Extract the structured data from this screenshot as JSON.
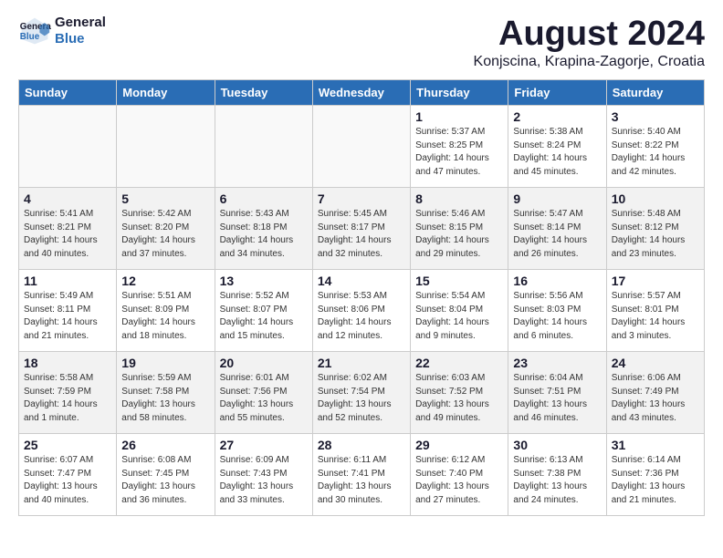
{
  "header": {
    "logo_line1": "General",
    "logo_line2": "Blue",
    "title": "August 2024",
    "subtitle": "Konjscina, Krapina-Zagorje, Croatia"
  },
  "days_of_week": [
    "Sunday",
    "Monday",
    "Tuesday",
    "Wednesday",
    "Thursday",
    "Friday",
    "Saturday"
  ],
  "weeks": [
    [
      {
        "day": "",
        "info": "",
        "empty": true
      },
      {
        "day": "",
        "info": "",
        "empty": true
      },
      {
        "day": "",
        "info": "",
        "empty": true
      },
      {
        "day": "",
        "info": "",
        "empty": true
      },
      {
        "day": "1",
        "info": "Sunrise: 5:37 AM\nSunset: 8:25 PM\nDaylight: 14 hours\nand 47 minutes."
      },
      {
        "day": "2",
        "info": "Sunrise: 5:38 AM\nSunset: 8:24 PM\nDaylight: 14 hours\nand 45 minutes."
      },
      {
        "day": "3",
        "info": "Sunrise: 5:40 AM\nSunset: 8:22 PM\nDaylight: 14 hours\nand 42 minutes."
      }
    ],
    [
      {
        "day": "4",
        "info": "Sunrise: 5:41 AM\nSunset: 8:21 PM\nDaylight: 14 hours\nand 40 minutes."
      },
      {
        "day": "5",
        "info": "Sunrise: 5:42 AM\nSunset: 8:20 PM\nDaylight: 14 hours\nand 37 minutes."
      },
      {
        "day": "6",
        "info": "Sunrise: 5:43 AM\nSunset: 8:18 PM\nDaylight: 14 hours\nand 34 minutes."
      },
      {
        "day": "7",
        "info": "Sunrise: 5:45 AM\nSunset: 8:17 PM\nDaylight: 14 hours\nand 32 minutes."
      },
      {
        "day": "8",
        "info": "Sunrise: 5:46 AM\nSunset: 8:15 PM\nDaylight: 14 hours\nand 29 minutes."
      },
      {
        "day": "9",
        "info": "Sunrise: 5:47 AM\nSunset: 8:14 PM\nDaylight: 14 hours\nand 26 minutes."
      },
      {
        "day": "10",
        "info": "Sunrise: 5:48 AM\nSunset: 8:12 PM\nDaylight: 14 hours\nand 23 minutes."
      }
    ],
    [
      {
        "day": "11",
        "info": "Sunrise: 5:49 AM\nSunset: 8:11 PM\nDaylight: 14 hours\nand 21 minutes."
      },
      {
        "day": "12",
        "info": "Sunrise: 5:51 AM\nSunset: 8:09 PM\nDaylight: 14 hours\nand 18 minutes."
      },
      {
        "day": "13",
        "info": "Sunrise: 5:52 AM\nSunset: 8:07 PM\nDaylight: 14 hours\nand 15 minutes."
      },
      {
        "day": "14",
        "info": "Sunrise: 5:53 AM\nSunset: 8:06 PM\nDaylight: 14 hours\nand 12 minutes."
      },
      {
        "day": "15",
        "info": "Sunrise: 5:54 AM\nSunset: 8:04 PM\nDaylight: 14 hours\nand 9 minutes."
      },
      {
        "day": "16",
        "info": "Sunrise: 5:56 AM\nSunset: 8:03 PM\nDaylight: 14 hours\nand 6 minutes."
      },
      {
        "day": "17",
        "info": "Sunrise: 5:57 AM\nSunset: 8:01 PM\nDaylight: 14 hours\nand 3 minutes."
      }
    ],
    [
      {
        "day": "18",
        "info": "Sunrise: 5:58 AM\nSunset: 7:59 PM\nDaylight: 14 hours\nand 1 minute."
      },
      {
        "day": "19",
        "info": "Sunrise: 5:59 AM\nSunset: 7:58 PM\nDaylight: 13 hours\nand 58 minutes."
      },
      {
        "day": "20",
        "info": "Sunrise: 6:01 AM\nSunset: 7:56 PM\nDaylight: 13 hours\nand 55 minutes."
      },
      {
        "day": "21",
        "info": "Sunrise: 6:02 AM\nSunset: 7:54 PM\nDaylight: 13 hours\nand 52 minutes."
      },
      {
        "day": "22",
        "info": "Sunrise: 6:03 AM\nSunset: 7:52 PM\nDaylight: 13 hours\nand 49 minutes."
      },
      {
        "day": "23",
        "info": "Sunrise: 6:04 AM\nSunset: 7:51 PM\nDaylight: 13 hours\nand 46 minutes."
      },
      {
        "day": "24",
        "info": "Sunrise: 6:06 AM\nSunset: 7:49 PM\nDaylight: 13 hours\nand 43 minutes."
      }
    ],
    [
      {
        "day": "25",
        "info": "Sunrise: 6:07 AM\nSunset: 7:47 PM\nDaylight: 13 hours\nand 40 minutes."
      },
      {
        "day": "26",
        "info": "Sunrise: 6:08 AM\nSunset: 7:45 PM\nDaylight: 13 hours\nand 36 minutes."
      },
      {
        "day": "27",
        "info": "Sunrise: 6:09 AM\nSunset: 7:43 PM\nDaylight: 13 hours\nand 33 minutes."
      },
      {
        "day": "28",
        "info": "Sunrise: 6:11 AM\nSunset: 7:41 PM\nDaylight: 13 hours\nand 30 minutes."
      },
      {
        "day": "29",
        "info": "Sunrise: 6:12 AM\nSunset: 7:40 PM\nDaylight: 13 hours\nand 27 minutes."
      },
      {
        "day": "30",
        "info": "Sunrise: 6:13 AM\nSunset: 7:38 PM\nDaylight: 13 hours\nand 24 minutes."
      },
      {
        "day": "31",
        "info": "Sunrise: 6:14 AM\nSunset: 7:36 PM\nDaylight: 13 hours\nand 21 minutes."
      }
    ]
  ]
}
